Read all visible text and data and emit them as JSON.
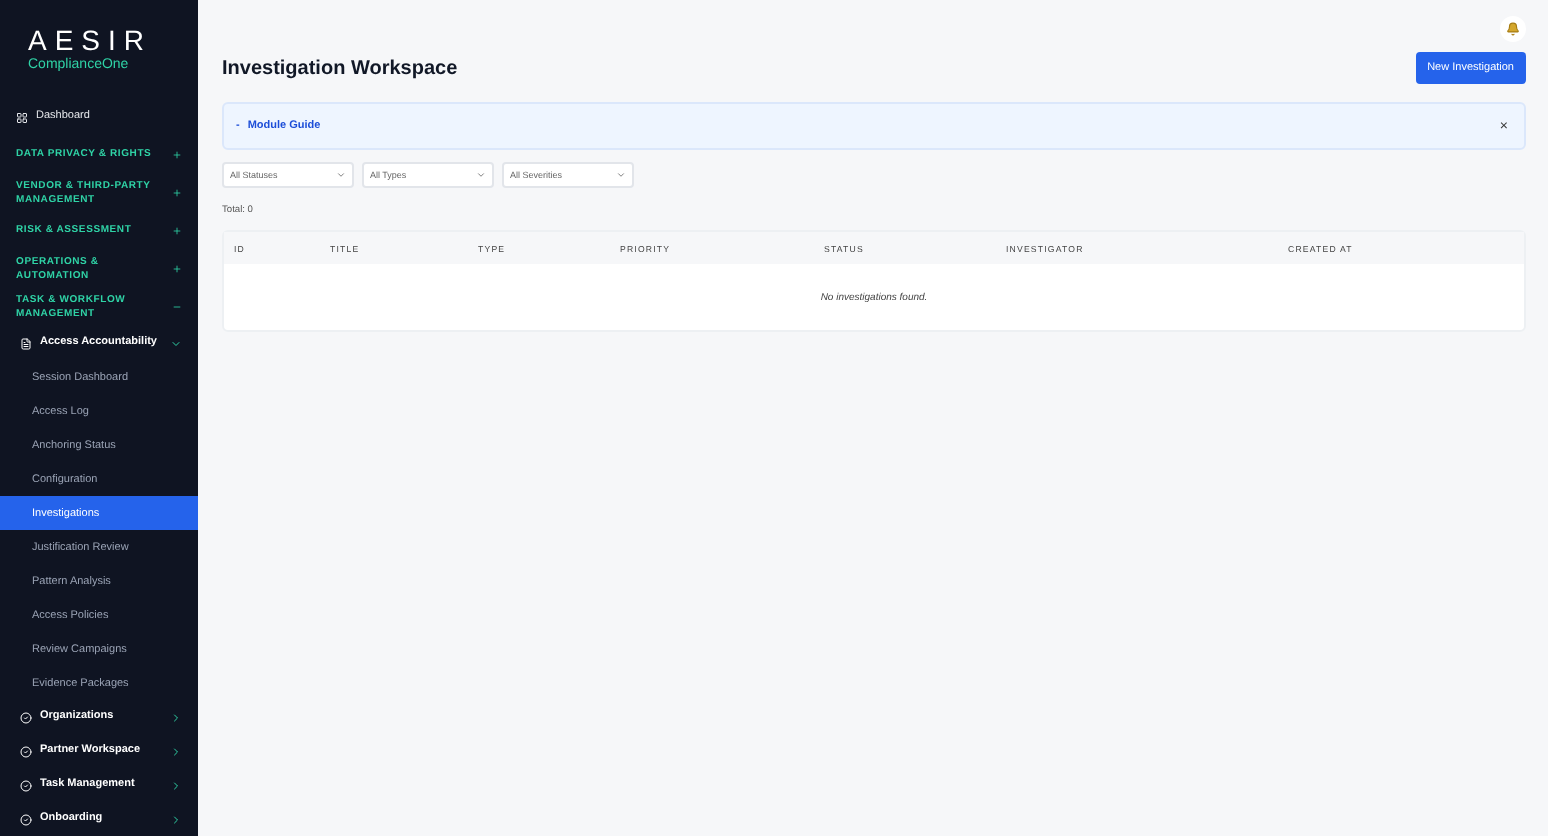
{
  "logo": {
    "title": "AESIR",
    "subtitle": "ComplianceOne"
  },
  "nav": [
    {
      "kind": "link",
      "label": "Dashboard"
    },
    {
      "kind": "section",
      "label": "DATA PRIVACY & RIGHTS",
      "expanded": false
    },
    {
      "kind": "section",
      "label": "VENDOR & THIRD-PARTY MANAGEMENT",
      "expanded": false
    },
    {
      "kind": "section",
      "label": "RISK & ASSESSMENT",
      "expanded": false
    },
    {
      "kind": "section",
      "label": "OPERATIONS & AUTOMATION",
      "expanded": false
    },
    {
      "kind": "section",
      "label": "TASK & WORKFLOW MANAGEMENT",
      "expanded": true
    },
    {
      "kind": "group",
      "label": "Access Accountability",
      "expanded": true,
      "children": [
        {
          "label": "Session Dashboard",
          "selected": false
        },
        {
          "label": "Access Log",
          "selected": false
        },
        {
          "label": "Anchoring Status",
          "selected": false
        },
        {
          "label": "Configuration",
          "selected": false
        },
        {
          "label": "Investigations",
          "selected": true
        },
        {
          "label": "Justification Review",
          "selected": false
        },
        {
          "label": "Pattern Analysis",
          "selected": false
        },
        {
          "label": "Access Policies",
          "selected": false
        },
        {
          "label": "Review Campaigns",
          "selected": false
        },
        {
          "label": "Evidence Packages",
          "selected": false
        }
      ]
    },
    {
      "kind": "group",
      "label": "Organizations",
      "expanded": false
    },
    {
      "kind": "group",
      "label": "Partner Workspace",
      "expanded": false
    },
    {
      "kind": "group",
      "label": "Task Management",
      "expanded": false
    },
    {
      "kind": "group",
      "label": "Onboarding",
      "expanded": false
    }
  ],
  "page": {
    "title": "Investigation Workspace",
    "primary_button": "New Investigation"
  },
  "guide": {
    "label": "Module Guide",
    "expanded": false,
    "toggle": "-",
    "close": "×"
  },
  "filters": [
    {
      "value": "All Statuses"
    },
    {
      "value": "All Types"
    },
    {
      "value": "All Severities"
    }
  ],
  "total": "Total: 0",
  "table": {
    "columns": [
      "ID",
      "TITLE",
      "TYPE",
      "PRIORITY",
      "STATUS",
      "INVESTIGATOR",
      "CREATED AT"
    ],
    "empty": "No investigations found."
  }
}
